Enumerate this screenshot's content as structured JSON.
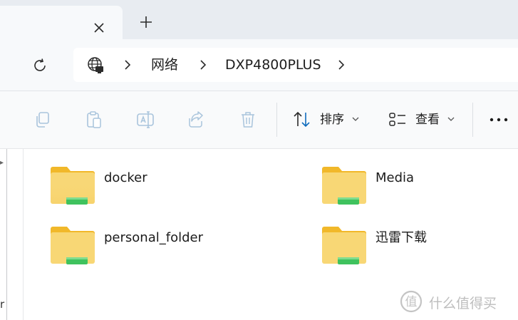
{
  "tab": {
    "close_icon": "close-icon",
    "new_tab_icon": "plus-icon"
  },
  "address": {
    "refresh_icon": "refresh-icon",
    "location_icon": "network-icon",
    "breadcrumbs": [
      "网络",
      "DXP4800PLUS"
    ]
  },
  "commandbar": {
    "copy_icon": "copy-icon",
    "paste_icon": "paste-icon",
    "rename_icon": "rename-icon",
    "share_icon": "share-icon",
    "delete_icon": "trash-icon",
    "sort_label": "排序",
    "view_label": "查看",
    "more_icon": "more-icon"
  },
  "items": [
    {
      "name": "docker"
    },
    {
      "name": "Media"
    },
    {
      "name": "personal_folder"
    },
    {
      "name": "迅雷下载"
    }
  ],
  "left_pane": {
    "visible_char": "r"
  },
  "watermark": {
    "text": "什么值得买"
  },
  "colors": {
    "folder_body": "#f8d775",
    "folder_tab": "#f1b82a",
    "folder_band": "#3fc25e"
  }
}
